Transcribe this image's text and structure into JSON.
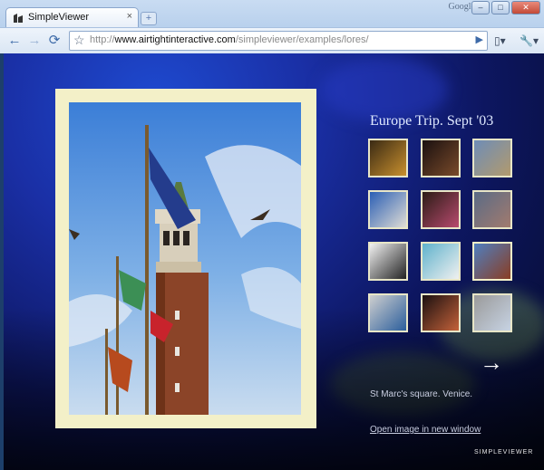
{
  "browser": {
    "tab_title": "SimpleViewer",
    "tab_close": "×",
    "new_tab": "+",
    "brand": "Google",
    "url_scheme": "http://",
    "url_domain": "www.airtightinteractive.com",
    "url_path": "/simpleviewer/examples/lores/",
    "icons": [
      "back-arrow-icon",
      "forward-arrow-icon",
      "reload-icon",
      "star-icon",
      "go-icon",
      "page-menu-icon",
      "wrench-icon"
    ]
  },
  "gallery": {
    "title": "Europe Trip. Sept '03",
    "caption": "St Marc's square. Venice.",
    "open_link": "Open image in new window",
    "logo": "SIMPLEVIEWER",
    "next_icon": "→",
    "selected_index": 8,
    "thumbnails": [
      {
        "name": "thumb-1",
        "colors": [
          "#3a2a14",
          "#c9902e"
        ]
      },
      {
        "name": "thumb-2",
        "colors": [
          "#1a1010",
          "#7a4b2a"
        ]
      },
      {
        "name": "thumb-3",
        "colors": [
          "#6e8db7",
          "#b29a6d"
        ]
      },
      {
        "name": "thumb-4",
        "colors": [
          "#2b5fb5",
          "#e0ddd5"
        ]
      },
      {
        "name": "thumb-5",
        "colors": [
          "#2b1c16",
          "#b84a6e"
        ]
      },
      {
        "name": "thumb-6",
        "colors": [
          "#5a6b86",
          "#a27b6e"
        ]
      },
      {
        "name": "thumb-7",
        "colors": [
          "#f2f2f2",
          "#222222"
        ]
      },
      {
        "name": "thumb-8",
        "colors": [
          "#5fb2cc",
          "#f0f0f0"
        ]
      },
      {
        "name": "thumb-9",
        "colors": [
          "#4f7fc0",
          "#8a3d22"
        ]
      },
      {
        "name": "thumb-10",
        "colors": [
          "#cfcfcf",
          "#2b5e9c"
        ]
      },
      {
        "name": "thumb-11",
        "colors": [
          "#1a1010",
          "#c4623a"
        ]
      },
      {
        "name": "thumb-12",
        "colors": [
          "#9a9a9a",
          "#c7d3e3"
        ]
      }
    ]
  }
}
